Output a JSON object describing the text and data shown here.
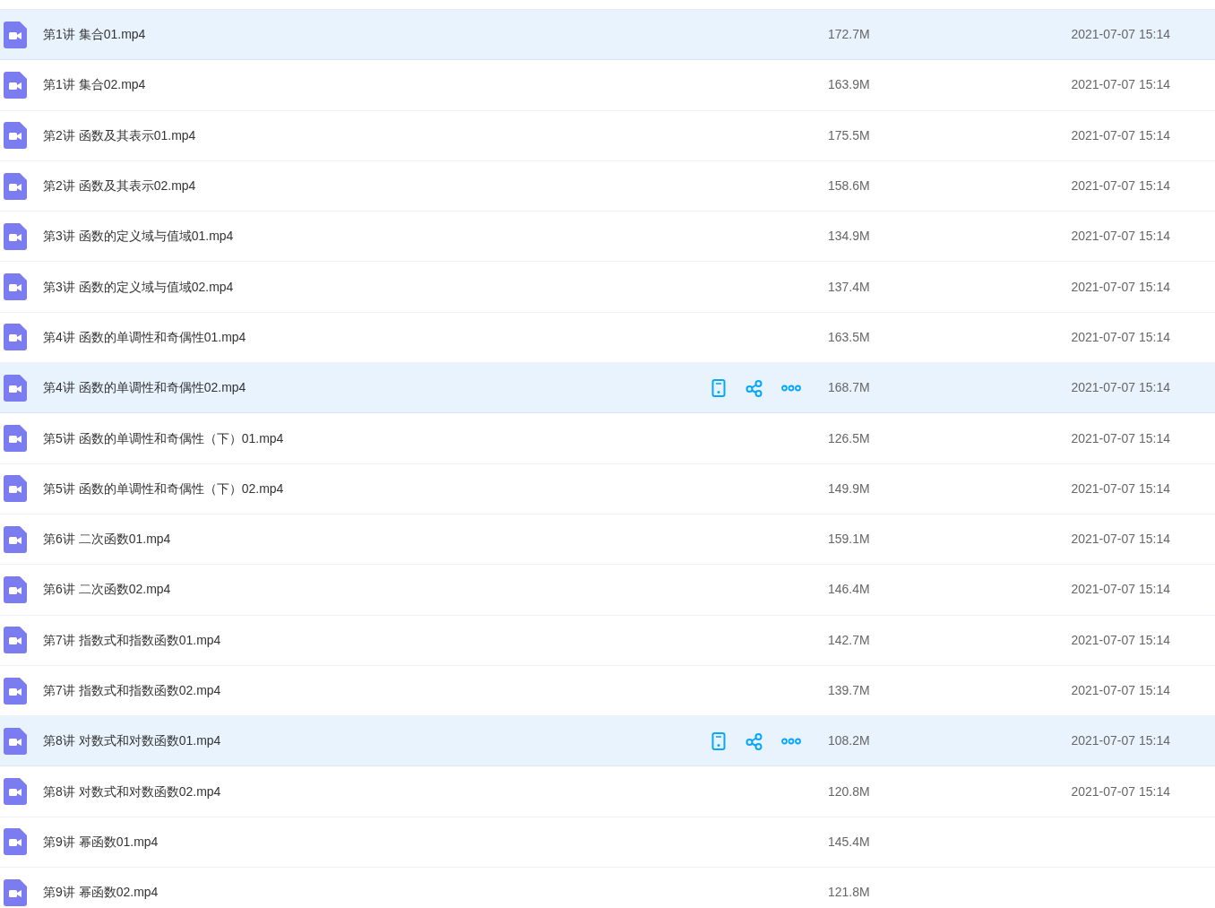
{
  "files": [
    {
      "name": "第1讲 集合01.mp4",
      "size": "172.7M",
      "modified": "2021-07-07 15:14",
      "highlighted": true,
      "actions": false
    },
    {
      "name": "第1讲 集合02.mp4",
      "size": "163.9M",
      "modified": "2021-07-07 15:14",
      "highlighted": false,
      "actions": false
    },
    {
      "name": "第2讲 函数及其表示01.mp4",
      "size": "175.5M",
      "modified": "2021-07-07 15:14",
      "highlighted": false,
      "actions": false
    },
    {
      "name": "第2讲 函数及其表示02.mp4",
      "size": "158.6M",
      "modified": "2021-07-07 15:14",
      "highlighted": false,
      "actions": false
    },
    {
      "name": "第3讲 函数的定义域与值域01.mp4",
      "size": "134.9M",
      "modified": "2021-07-07 15:14",
      "highlighted": false,
      "actions": false
    },
    {
      "name": "第3讲 函数的定义域与值域02.mp4",
      "size": "137.4M",
      "modified": "2021-07-07 15:14",
      "highlighted": false,
      "actions": false
    },
    {
      "name": "第4讲 函数的单调性和奇偶性01.mp4",
      "size": "163.5M",
      "modified": "2021-07-07 15:14",
      "highlighted": false,
      "actions": false
    },
    {
      "name": "第4讲 函数的单调性和奇偶性02.mp4",
      "size": "168.7M",
      "modified": "2021-07-07 15:14",
      "highlighted": true,
      "actions": true
    },
    {
      "name": "第5讲 函数的单调性和奇偶性（下）01.mp4",
      "size": "126.5M",
      "modified": "2021-07-07 15:14",
      "highlighted": false,
      "actions": false
    },
    {
      "name": "第5讲 函数的单调性和奇偶性（下）02.mp4",
      "size": "149.9M",
      "modified": "2021-07-07 15:14",
      "highlighted": false,
      "actions": false
    },
    {
      "name": "第6讲 二次函数01.mp4",
      "size": "159.1M",
      "modified": "2021-07-07 15:14",
      "highlighted": false,
      "actions": false
    },
    {
      "name": "第6讲 二次函数02.mp4",
      "size": "146.4M",
      "modified": "2021-07-07 15:14",
      "highlighted": false,
      "actions": false
    },
    {
      "name": "第7讲 指数式和指数函数01.mp4",
      "size": "142.7M",
      "modified": "2021-07-07 15:14",
      "highlighted": false,
      "actions": false
    },
    {
      "name": "第7讲 指数式和指数函数02.mp4",
      "size": "139.7M",
      "modified": "2021-07-07 15:14",
      "highlighted": false,
      "actions": false
    },
    {
      "name": "第8讲 对数式和对数函数01.mp4",
      "size": "108.2M",
      "modified": "2021-07-07 15:14",
      "highlighted": true,
      "actions": true
    },
    {
      "name": "第8讲 对数式和对数函数02.mp4",
      "size": "120.8M",
      "modified": "2021-07-07 15:14",
      "highlighted": false,
      "actions": false
    },
    {
      "name": "第9讲 幂函数01.mp4",
      "size": "145.4M",
      "highlighted": false,
      "actions": false
    },
    {
      "name": "第9讲 幂函数02.mp4",
      "size": "121.8M",
      "highlighted": false,
      "actions": false
    }
  ]
}
